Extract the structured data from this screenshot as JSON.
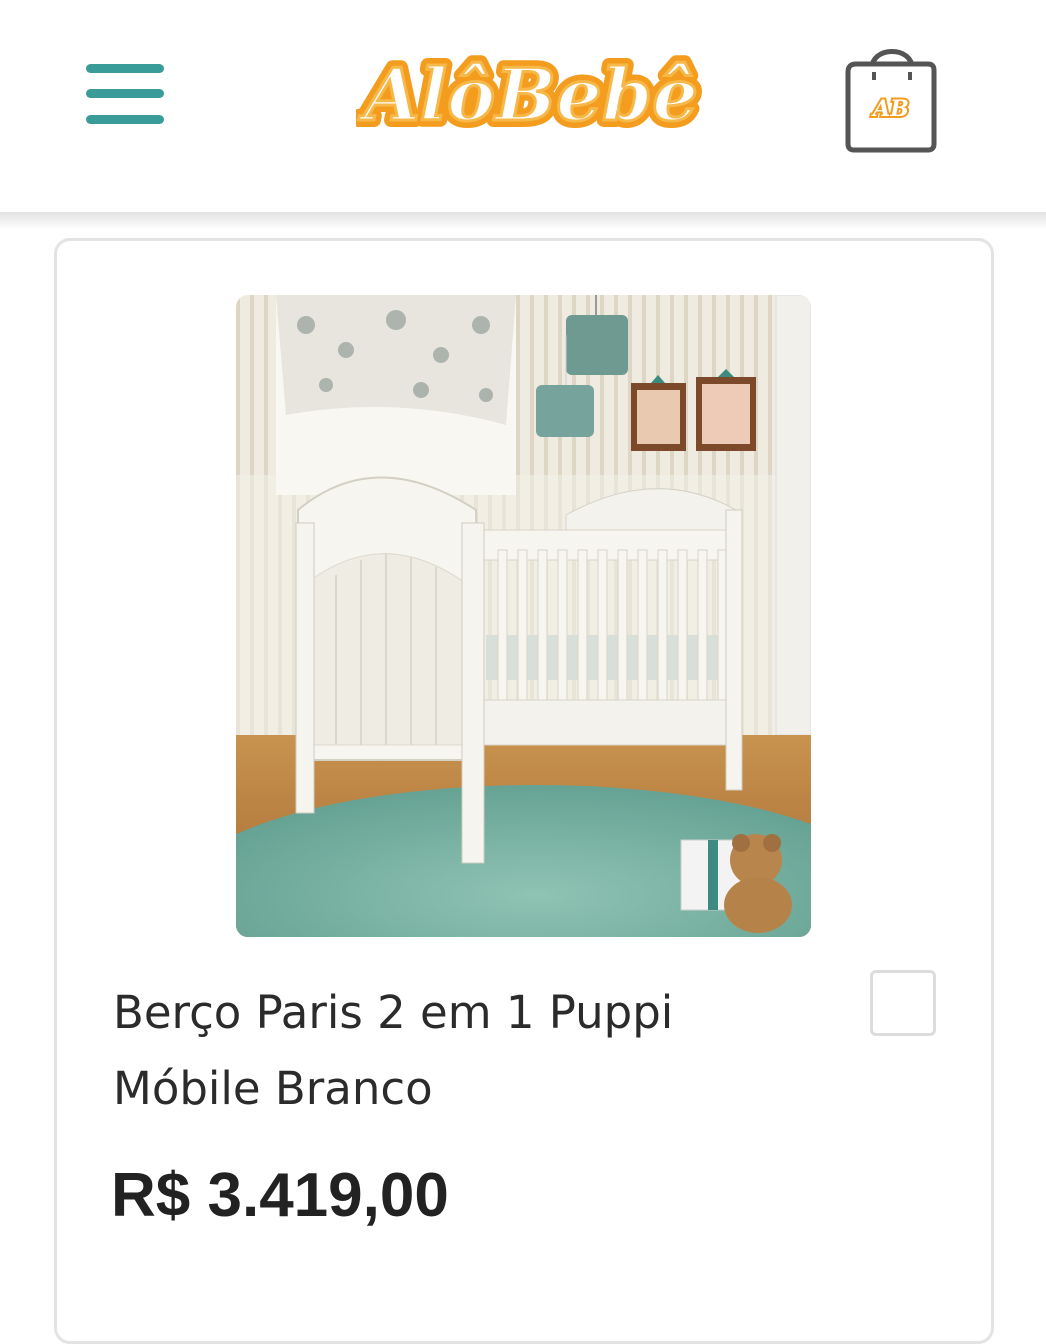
{
  "header": {
    "logo_text": "AlôBebê",
    "menu_icon": "hamburger-menu-icon",
    "cart_icon": "shopping-bag-icon",
    "cart_badge_text": "AB"
  },
  "product": {
    "name_line1": "Berço Paris 2 em 1 Puppi",
    "name_line2": "Móbile Branco",
    "price": "R$ 3.419,00",
    "image_alt": "Berço Paris 2 em 1 Puppi Móbile Branco"
  },
  "colors": {
    "accent_teal": "#3a9c98",
    "logo_orange": "#f39c1e",
    "text_dark": "#222222"
  }
}
